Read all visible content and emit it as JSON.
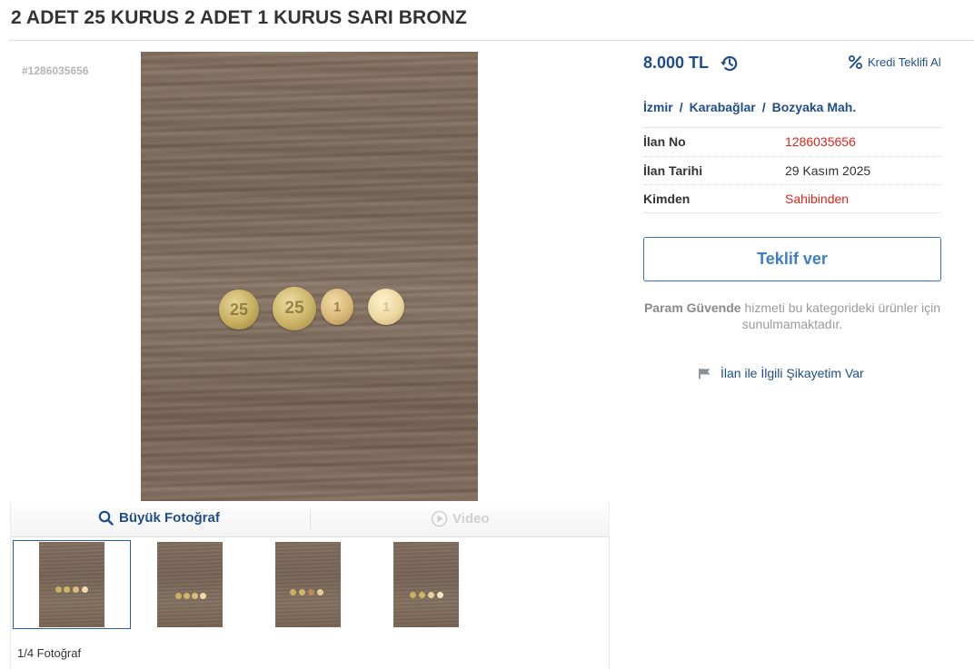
{
  "listing": {
    "title": "2 ADET 25 KURUS 2 ADET 1 KURUS SARI BRONZ",
    "id_tag": "#1286035656"
  },
  "gallery": {
    "big_photo_label": "Büyük Fotoğraf",
    "video_label": "Video",
    "photo_count": "1/4 Fotoğraf",
    "coin_labels": [
      "25",
      "25",
      "1",
      "1"
    ],
    "thumbnails": [
      {
        "active": true
      },
      {
        "active": false
      },
      {
        "active": false
      },
      {
        "active": false
      }
    ]
  },
  "pricing": {
    "price": "8.000 TL",
    "credit_offer_label": "Kredi Teklifi Al"
  },
  "location": {
    "city": "İzmir",
    "district": "Karabağlar",
    "neighborhood": "Bozyaka Mah.",
    "separator": "/"
  },
  "info": [
    {
      "key": "İlan No",
      "value": "1286035656",
      "color": "#e0241b"
    },
    {
      "key": "İlan Tarihi",
      "value": "29 Kasım 2025",
      "color": "#333333"
    },
    {
      "key": "Kimden",
      "value": "Sahibinden",
      "color": "#e0241b"
    }
  ],
  "actions": {
    "offer_button": "Teklif ver",
    "secure_bold": "Param Güvende",
    "secure_text": " hizmeti bu kategorideki ürünler için sunulmamaktadır.",
    "complaint": "İlan ile İlgili Şikayetim Var"
  },
  "colors": {
    "link_blue": "#1f4d8c",
    "accent_red": "#e0241b",
    "button_blue": "#3c7fc4"
  },
  "icons": [
    "history-icon",
    "percent-icon",
    "search-icon",
    "play-icon",
    "flag-icon"
  ]
}
